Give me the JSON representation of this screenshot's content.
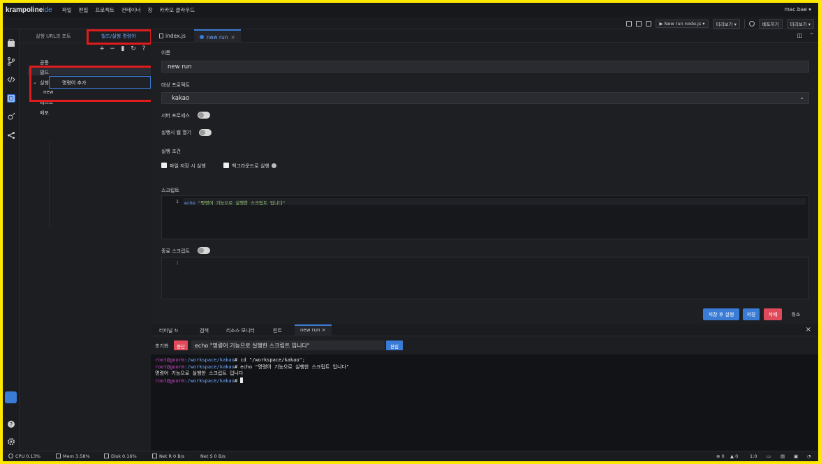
{
  "menubar": {
    "logo_main": "krampoline",
    "logo_ide": "ide",
    "items": [
      "파일",
      "편집",
      "프로젝트",
      "컨테이너",
      "창",
      "카카오 클라우드"
    ],
    "user": "mac.bae ▾"
  },
  "toolbar": {
    "run_config": "▶ New run node.js ▾",
    "preview": "미리보기 ▾",
    "share": "배포하기",
    "preview2": "미리보기 ▾"
  },
  "side": {
    "tab_ports": "실행 URL과 포트",
    "tab_commands": "빌드/실행 명령어",
    "tools": [
      "+",
      "−",
      "▮",
      "↻",
      "?"
    ],
    "tree": {
      "common": "공통",
      "build": "빌드",
      "run": "실행",
      "run_child": "new",
      "test": "테스트",
      "deploy": "배포"
    },
    "popup_label": "명령어 추가"
  },
  "editor": {
    "tabs": [
      {
        "label": "index.js"
      },
      {
        "label": "new run",
        "close": "×"
      }
    ],
    "name_label": "이름",
    "name_value": "new run",
    "target_label": "대상 프로젝트",
    "target_value": "kakao",
    "server_process_label": "서버 프로세스",
    "open_web_label": "실행시 웹 열기",
    "run_condition_label": "실행 조건",
    "on_save_label": "파일 저장 시 실행",
    "background_label": "백그라운드로 실행",
    "script_label": "스크립트",
    "script_line_no": "1",
    "script_kw": "echo",
    "script_text": "\"명령어 기능으로 실행한 스크립트 입니다\"",
    "end_script_label": "종료 스크립트",
    "end_line_no": "1",
    "buttons": {
      "save_run": "저장 후 실행",
      "save": "저장",
      "delete": "삭제",
      "cancel": "취소"
    }
  },
  "terminal": {
    "tabs": [
      "터미널",
      "검색",
      "리소스 모니터",
      "린트",
      "new run"
    ],
    "active_close": "×",
    "close": "×",
    "reset_label": "초기화",
    "stop_label": "중단",
    "command": "echo \"명령어 기능으로 실행한 스크립트 입니다\"",
    "edit_label": "편집",
    "prompt_user": "root@goorm",
    "prompt_path": ":/workspace/kakao",
    "line1_cmd": "# cd \"/workspace/kakao\";",
    "line2_cmd": "# echo \"명령어 기능으로 실행한 스크립트 입니다\"",
    "line3_output": "명령어 기능으로 실행한 스크립트 입니다",
    "line4_cmd": "# "
  },
  "statusbar": {
    "cpu": "CPU 0.13%",
    "mem": "Mem 3.58%",
    "disk": "Disk 0.16%",
    "net_r": "Net R 0 B/s",
    "net_s": "Net S 0 B/s",
    "errors": "0",
    "warnings": "0",
    "position": "1:0"
  },
  "colors": {
    "accent": "#3a7bd5",
    "danger": "#e04a5a",
    "highlight_box": "#e01b1b",
    "frame": "#ffe800"
  }
}
